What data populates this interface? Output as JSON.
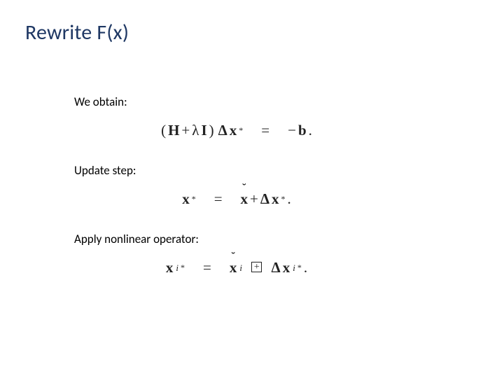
{
  "title": "Rewrite F(x)",
  "sections": {
    "obtain": {
      "label": "We obtain:"
    },
    "update": {
      "label": "Update step:"
    },
    "apply": {
      "label": "Apply nonlinear operator:"
    }
  },
  "eq1": {
    "lparen": "(",
    "H": "H",
    "plus": " + ",
    "lambda": "λ",
    "I": "I",
    "rparen": ")",
    "sp": " ",
    "Delta": "Δ",
    "x": "x",
    "star": "*",
    "eq": "=",
    "minus": "−",
    "b": "b",
    "period": "."
  },
  "eq2": {
    "x": "x",
    "star": "*",
    "eq": "=",
    "xb": "x",
    "plus": " + ",
    "Delta": "Δ",
    "x2": "x",
    "star2": "*",
    "period": "."
  },
  "eq3": {
    "x": "x",
    "i": "i",
    "star": "*",
    "eq": "=",
    "xb": "x",
    "i2": "i",
    "boxplus": "+",
    "Delta": "Δ",
    "x2": "x",
    "i3": "i",
    "star2": "*",
    "period": "."
  }
}
